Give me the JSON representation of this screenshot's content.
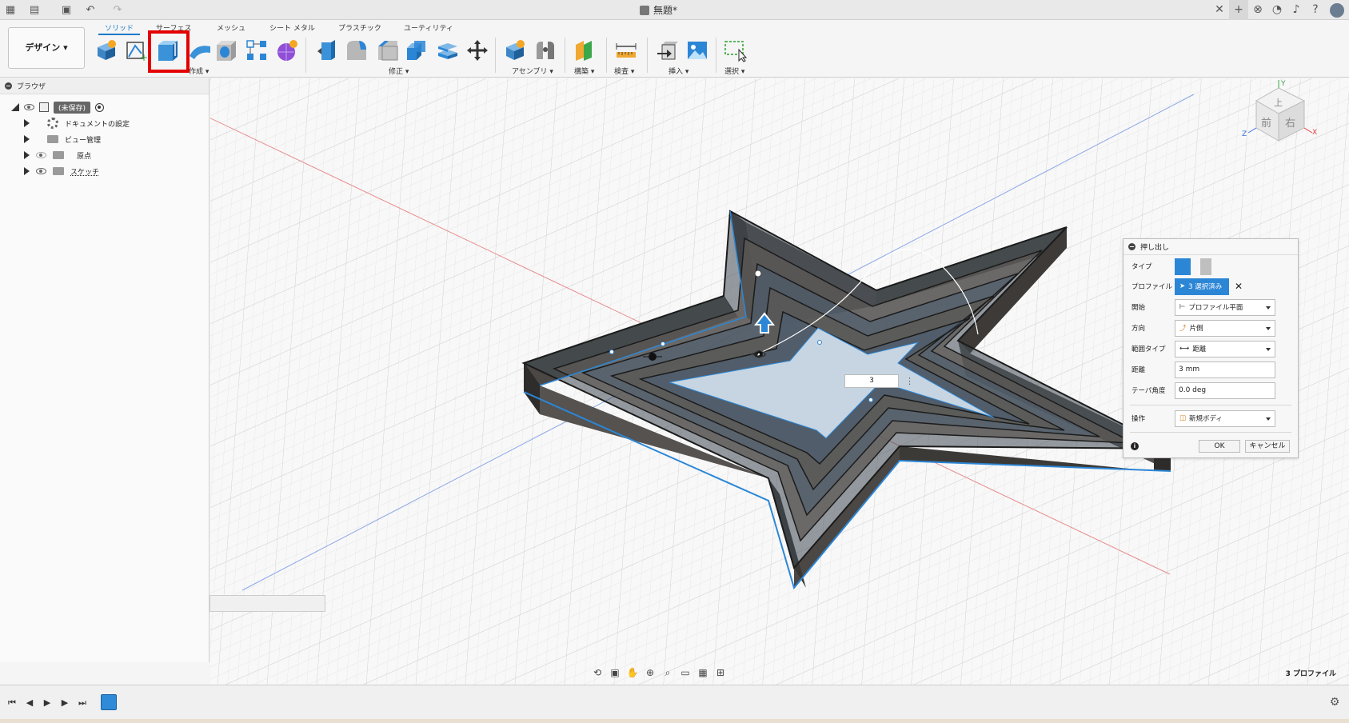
{
  "window": {
    "title": "無題*"
  },
  "ribbon": {
    "design_label": "デザイン ▾",
    "tabs": [
      "ソリッド",
      "サーフェス",
      "メッシュ",
      "シート メタル",
      "プラスチック",
      "ユーティリティ"
    ],
    "groups": {
      "create": "作成 ▾",
      "modify": "修正 ▾",
      "assemble": "アセンブリ ▾",
      "construct": "構築 ▾",
      "inspect": "検査 ▾",
      "insert": "挿入 ▾",
      "select": "選択 ▾"
    }
  },
  "browser": {
    "title": "ブラウザ",
    "root_label": "(未保存)",
    "items": [
      {
        "label": "ドキュメントの設定"
      },
      {
        "label": "ビュー管理"
      },
      {
        "label": "原点"
      },
      {
        "label": "スケッチ"
      }
    ]
  },
  "viewcube": {
    "top": "上",
    "front": "前",
    "right": "右",
    "axis_x": "X",
    "axis_y": "Y",
    "axis_z": "Z"
  },
  "manipulator": {
    "value": "3"
  },
  "dialog": {
    "title": "押し出し",
    "type_label": "タイプ",
    "profile_label": "プロファイル",
    "profile_value": "3 選択済み",
    "start_label": "開始",
    "start_value": "プロファイル平面",
    "direction_label": "方向",
    "direction_value": "片側",
    "extent_label": "範囲タイプ",
    "extent_value": "距離",
    "distance_label": "距離",
    "distance_value": "3 mm",
    "taper_label": "テーパ角度",
    "taper_value": "0.0 deg",
    "operation_label": "操作",
    "operation_value": "新規ボディ",
    "ok": "OK",
    "cancel": "キャンセル"
  },
  "status": {
    "profile_count": "3 プロファイル"
  },
  "colors": {
    "accent": "#2c86d6",
    "highlight": "#e40000",
    "extrusion": "#4b4b4b"
  }
}
